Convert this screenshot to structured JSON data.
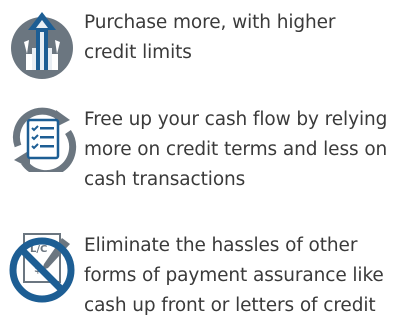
{
  "colors": {
    "text": "#3a3a3a",
    "icon_blue": "#1d5e94",
    "icon_gray": "#6b7680",
    "icon_light": "#e9eef3"
  },
  "benefits": [
    {
      "icon": "rising-arrows-icon",
      "lines": [
        "Purchase more, with higher",
        "credit limits"
      ]
    },
    {
      "icon": "checklist-cycle-icon",
      "lines": [
        "Free up your cash flow by relying",
        "more on credit terms and less on",
        "cash transactions"
      ]
    },
    {
      "icon": "no-letter-of-credit-icon",
      "icon_text": [
        "L/C",
        "$"
      ],
      "lines": [
        "Eliminate the hassles of other",
        "forms of payment assurance like",
        "cash up front or letters of credit"
      ]
    }
  ]
}
